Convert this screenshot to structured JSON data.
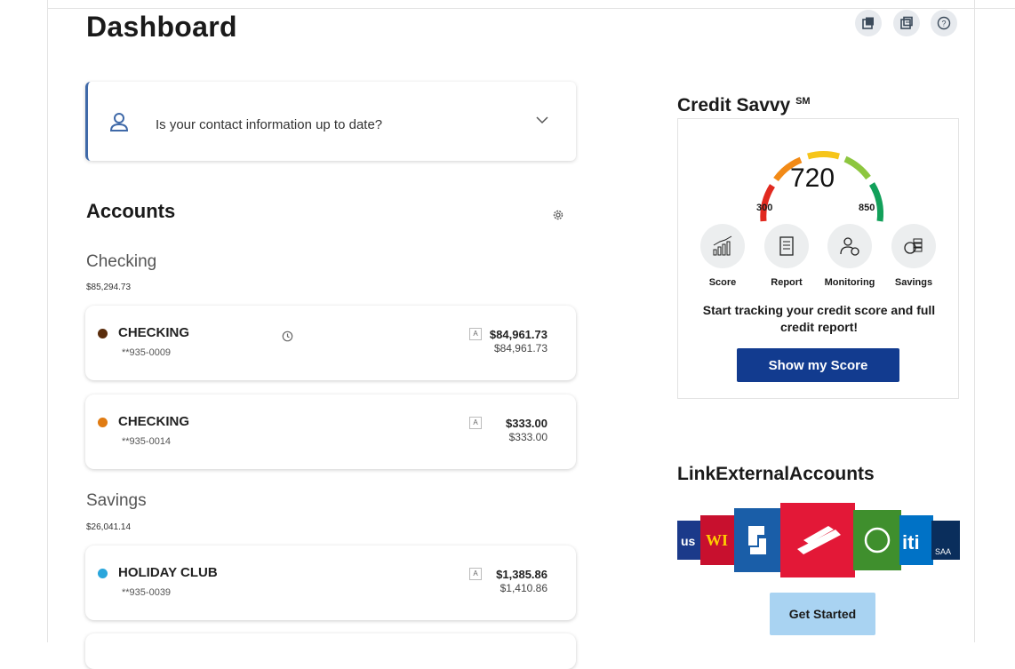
{
  "page": {
    "title": "Dashboard"
  },
  "toolbar": {
    "icons": [
      "share-icon",
      "print-icon",
      "help-icon"
    ]
  },
  "contact": {
    "text": "Is your contact information up to date?"
  },
  "accounts": {
    "title": "Accounts",
    "groups": [
      {
        "label": "Checking",
        "total": "$85,294.73",
        "items": [
          {
            "name": "CHECKING",
            "number": "**935-0009",
            "balance": "$84,961.73",
            "available": "$84,961.73",
            "dot_color": "#5a2d0c",
            "badge": "A",
            "pending_icon": true
          },
          {
            "name": "CHECKING",
            "number": "**935-0014",
            "balance": "$333.00",
            "available": "$333.00",
            "dot_color": "#e07b12",
            "badge": "A",
            "pending_icon": false
          }
        ]
      },
      {
        "label": "Savings",
        "total": "$26,041.14",
        "items": [
          {
            "name": "HOLIDAY CLUB",
            "number": "**935-0039",
            "balance": "$1,385.86",
            "available": "$1,410.86",
            "dot_color": "#2aa6dc",
            "badge": "A",
            "pending_icon": false
          }
        ]
      }
    ]
  },
  "credit": {
    "title": "Credit Savvy",
    "mark": "SM",
    "score": "720",
    "min": "300",
    "max": "850",
    "features": [
      "Score",
      "Report",
      "Monitoring",
      "Savings"
    ],
    "message": "Start tracking your credit score and full credit report!",
    "button": "Show my Score"
  },
  "external": {
    "title": "LinkExternalAccounts",
    "button": "Get Started"
  },
  "colors": {
    "accent": "#3f69a8",
    "primary_button": "#123b8f",
    "secondary_button": "#a9d3f2"
  }
}
